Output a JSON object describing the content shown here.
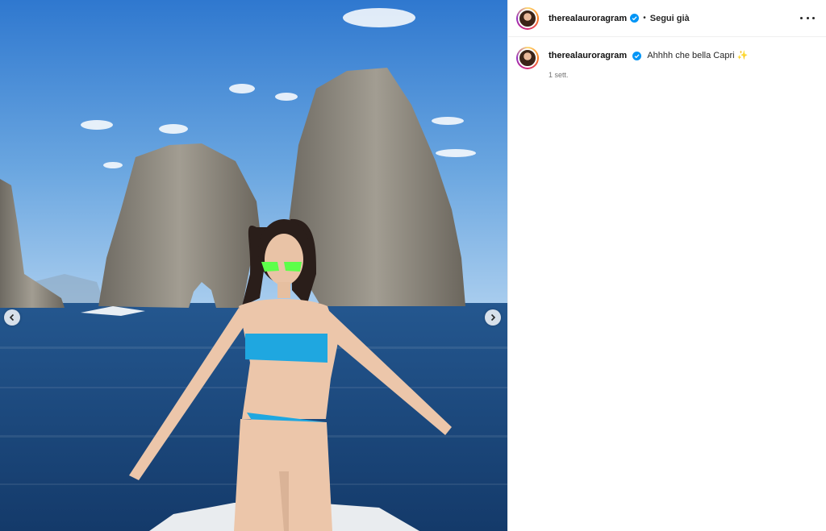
{
  "post": {
    "username": "therealauroragram",
    "follow_status": "Segui già",
    "separator": "•",
    "caption": "Ahhhh che bella Capri ✨",
    "time": "1 sett."
  },
  "media": {
    "image_description_icon": "photo",
    "has_prev": true,
    "has_next": true
  },
  "colors": {
    "verified": "#0095f6",
    "sky": "#4a8fd6",
    "sea": "#1e4f8c"
  },
  "icons": [
    "verified-badge-icon",
    "more-options-icon",
    "chevron-left-icon",
    "chevron-right-icon"
  ]
}
